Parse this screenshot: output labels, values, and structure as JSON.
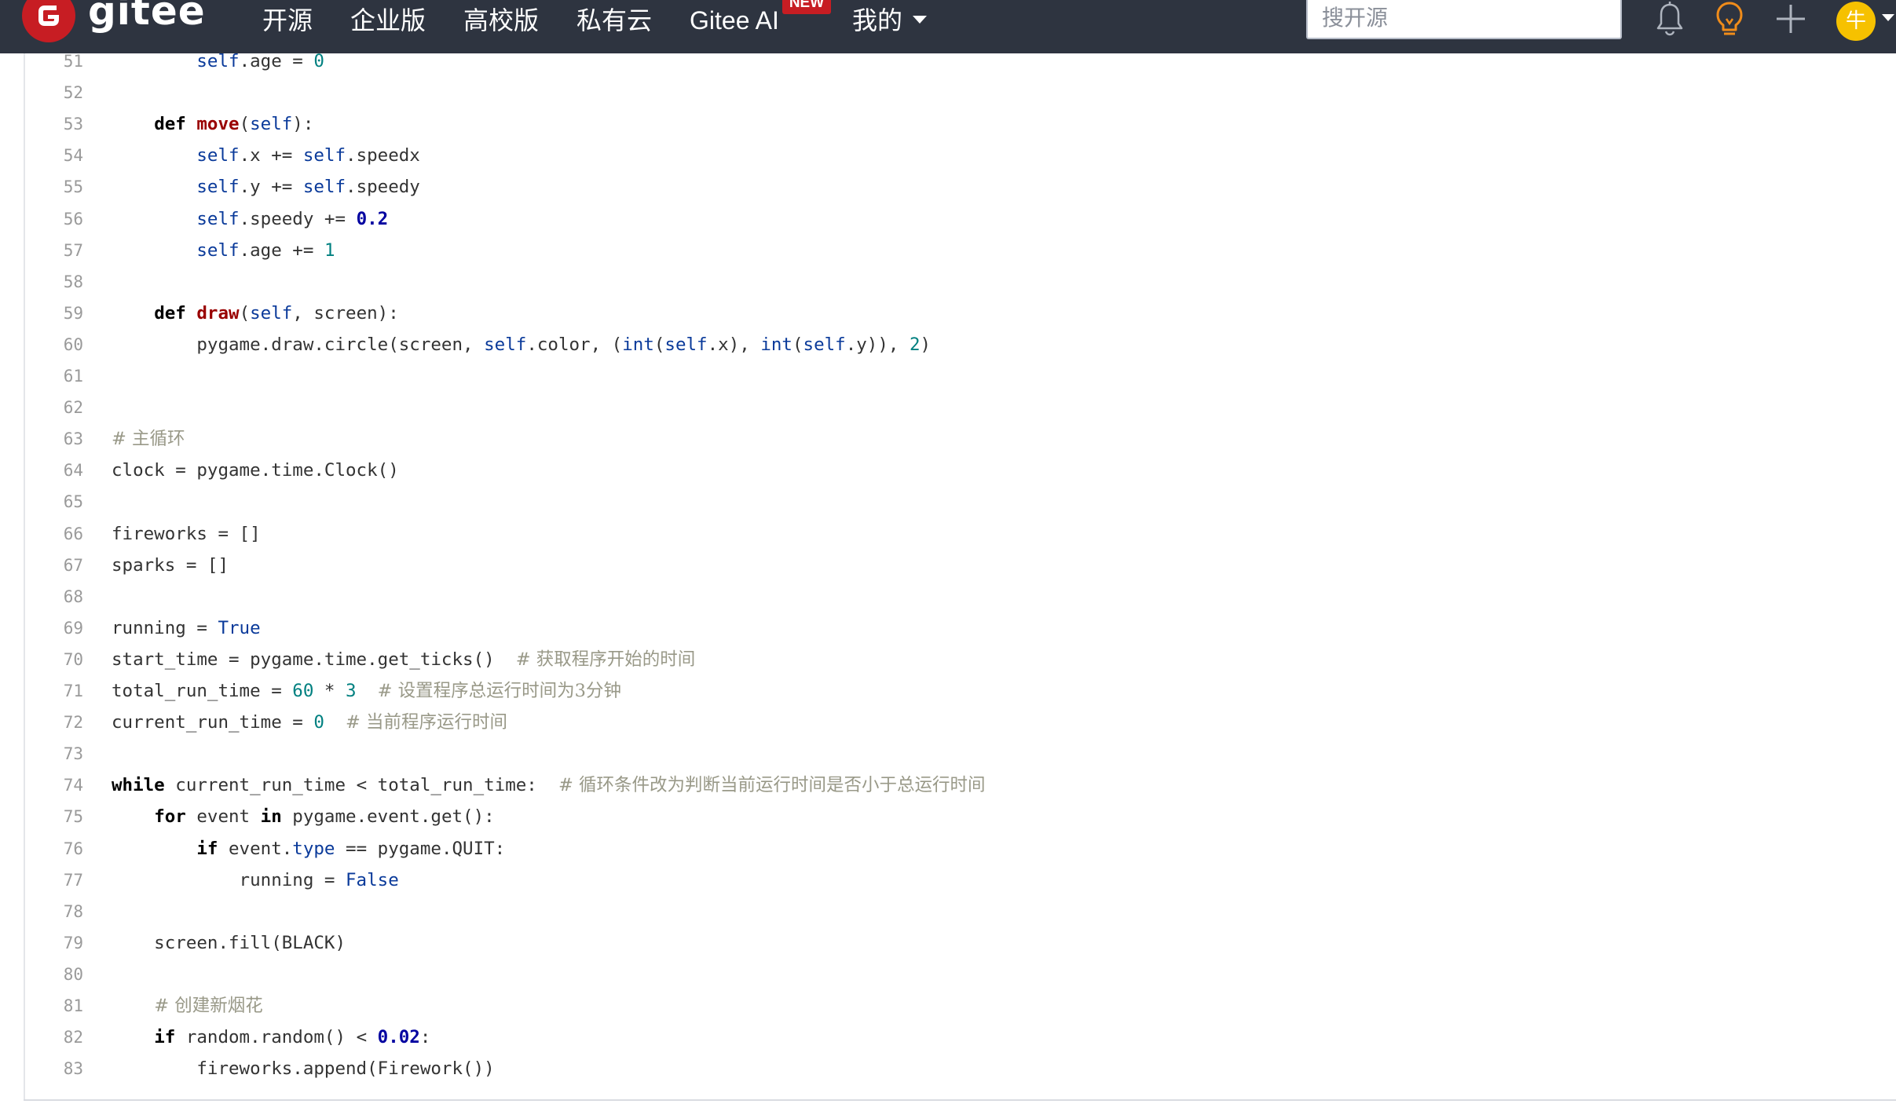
{
  "nav": {
    "logo_text": "gitee",
    "items": [
      {
        "label": "开源"
      },
      {
        "label": "企业版"
      },
      {
        "label": "高校版"
      },
      {
        "label": "私有云"
      },
      {
        "label": "Gitee AI"
      },
      {
        "label": "我的"
      }
    ],
    "new_badge": "NEW",
    "search_placeholder": "搜开源",
    "avatar_text": "牛",
    "icons": [
      "bell-icon",
      "lightbulb-icon",
      "plus-icon"
    ],
    "colors": {
      "bar": "#2e3440",
      "brand": "#c71d23",
      "avatar": "#f6c100"
    }
  },
  "code": {
    "lines": [
      {
        "num": "51",
        "text": "        self.age = 0"
      },
      {
        "num": "52",
        "text": ""
      },
      {
        "num": "53",
        "text": "    def move(self):"
      },
      {
        "num": "54",
        "text": "        self.x += self.speedx"
      },
      {
        "num": "55",
        "text": "        self.y += self.speedy"
      },
      {
        "num": "56",
        "text": "        self.speedy += 0.2"
      },
      {
        "num": "57",
        "text": "        self.age += 1"
      },
      {
        "num": "58",
        "text": ""
      },
      {
        "num": "59",
        "text": "    def draw(self, screen):"
      },
      {
        "num": "60",
        "text": "        pygame.draw.circle(screen, self.color, (int(self.x), int(self.y)), 2)"
      },
      {
        "num": "61",
        "text": ""
      },
      {
        "num": "62",
        "text": ""
      },
      {
        "num": "63",
        "text": "# 主循环"
      },
      {
        "num": "64",
        "text": "clock = pygame.time.Clock()"
      },
      {
        "num": "65",
        "text": ""
      },
      {
        "num": "66",
        "text": "fireworks = []"
      },
      {
        "num": "67",
        "text": "sparks = []"
      },
      {
        "num": "68",
        "text": ""
      },
      {
        "num": "69",
        "text": "running = True"
      },
      {
        "num": "70",
        "text": "start_time = pygame.time.get_ticks()  # 获取程序开始的时间"
      },
      {
        "num": "71",
        "text": "total_run_time = 60 * 3  # 设置程序总运行时间为3分钟"
      },
      {
        "num": "72",
        "text": "current_run_time = 0  # 当前程序运行时间"
      },
      {
        "num": "73",
        "text": ""
      },
      {
        "num": "74",
        "text": "while current_run_time < total_run_time:  # 循环条件改为判断当前运行时间是否小于总运行时间"
      },
      {
        "num": "75",
        "text": "    for event in pygame.event.get():"
      },
      {
        "num": "76",
        "text": "        if event.type == pygame.QUIT:"
      },
      {
        "num": "77",
        "text": "            running = False"
      },
      {
        "num": "78",
        "text": ""
      },
      {
        "num": "79",
        "text": "    screen.fill(BLACK)"
      },
      {
        "num": "80",
        "text": ""
      },
      {
        "num": "81",
        "text": "    # 创建新烟花"
      },
      {
        "num": "82",
        "text": "    if random.random() < 0.02:"
      },
      {
        "num": "83",
        "text": "        fireworks.append(Firework())"
      }
    ]
  }
}
